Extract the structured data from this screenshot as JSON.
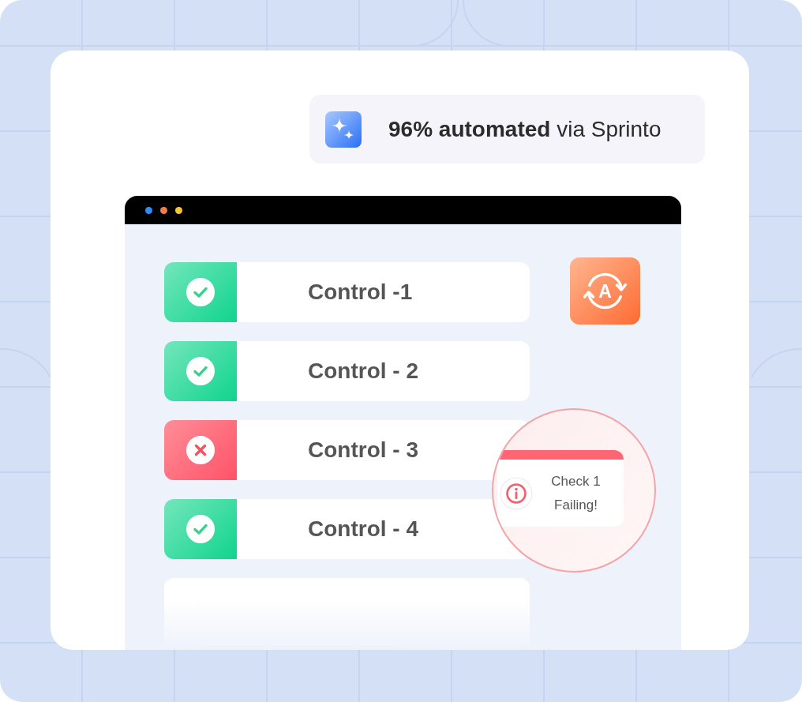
{
  "badge": {
    "text": "**96% automated** via Sprinto"
  },
  "window": {
    "dots": [
      {
        "color": "#2f8cf5"
      },
      {
        "color": "#f57c4a"
      },
      {
        "color": "#f8c531"
      }
    ]
  },
  "controls": [
    {
      "label": "Control -1",
      "passed": true
    },
    {
      "label": "Control - 2",
      "passed": true
    },
    {
      "label": "Control - 3",
      "passed": false
    },
    {
      "label": "Control - 4",
      "passed": true
    }
  ],
  "auto_tile": {
    "letter": "A"
  },
  "alert": {
    "title": "Check 1",
    "message": "Failing!"
  }
}
